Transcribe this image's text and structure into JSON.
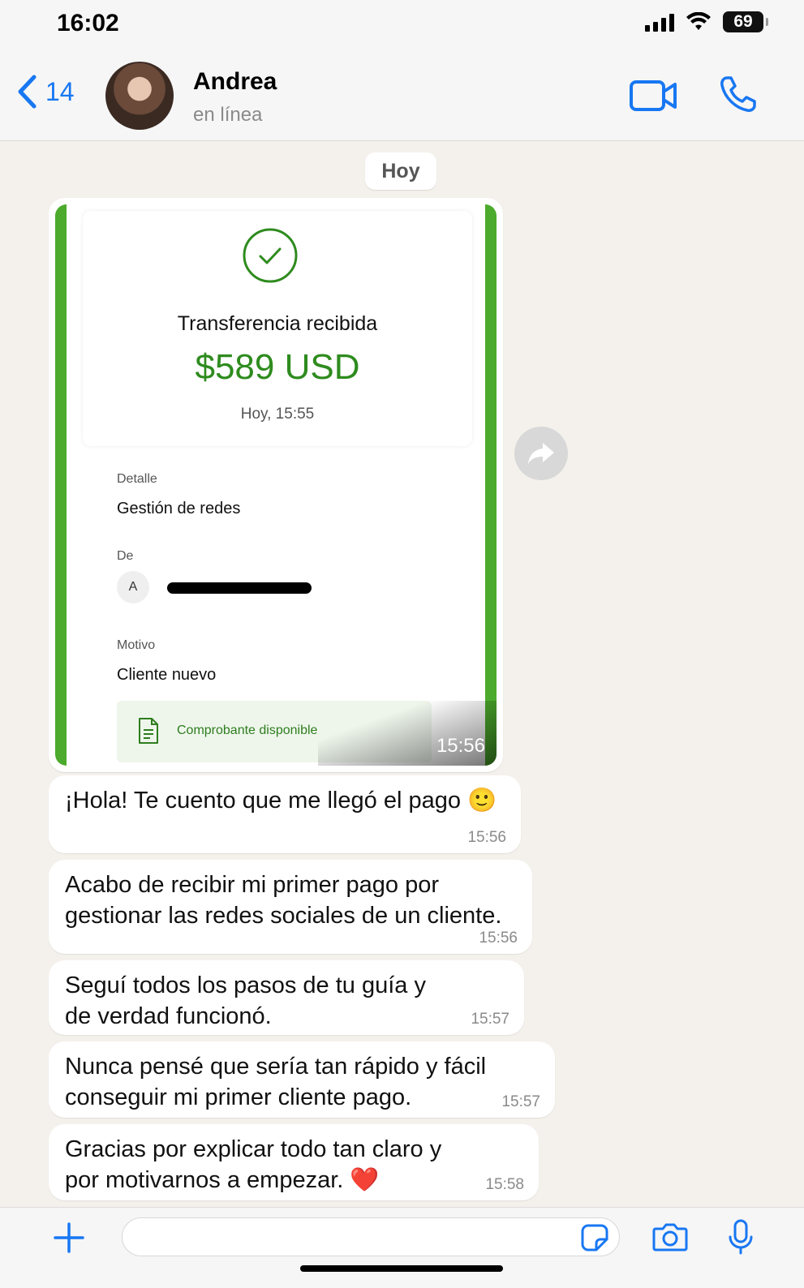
{
  "status_bar": {
    "time": "16:02",
    "battery": "69"
  },
  "header": {
    "back_count": "14",
    "contact_name": "Andrea",
    "contact_status": "en línea"
  },
  "date_chip": "Hoy",
  "receipt": {
    "title": "Transferencia recibida",
    "amount": "$589 USD",
    "date": "Hoy, 15:55",
    "detail_label": "Detalle",
    "detail_value": "Gestión de redes",
    "from_label": "De",
    "from_initial": "A",
    "reason_label": "Motivo",
    "reason_value": "Cliente nuevo",
    "proof_label": "Comprobante disponible",
    "message_time": "15:56"
  },
  "messages": [
    {
      "text": "¡Hola! Te cuento que me llegó el pago 🙂",
      "time": "15:56"
    },
    {
      "text": "Acabo de recibir mi primer pago por gestionar las redes sociales de un cliente.",
      "time": "15:56"
    },
    {
      "text": "Seguí todos los pasos de tu guía y de verdad funcionó.",
      "time": "15:57"
    },
    {
      "text": "Nunca pensé que sería tan rápido y fácil conseguir mi primer cliente pago.",
      "time": "15:57"
    },
    {
      "text": "Gracias por explicar todo tan claro y por motivarnos a empezar. ❤️",
      "time": "15:58"
    }
  ],
  "colors": {
    "accent": "#1877f2",
    "receipt_green": "#4caa2c",
    "amount_green": "#2e8b1e",
    "chat_bg": "#f4f1ec"
  },
  "icons": [
    "chevron-left-icon",
    "video-call-icon",
    "phone-icon",
    "check-circle-icon",
    "document-icon",
    "forward-icon",
    "plus-icon",
    "sticker-icon",
    "camera-icon",
    "microphone-icon"
  ]
}
